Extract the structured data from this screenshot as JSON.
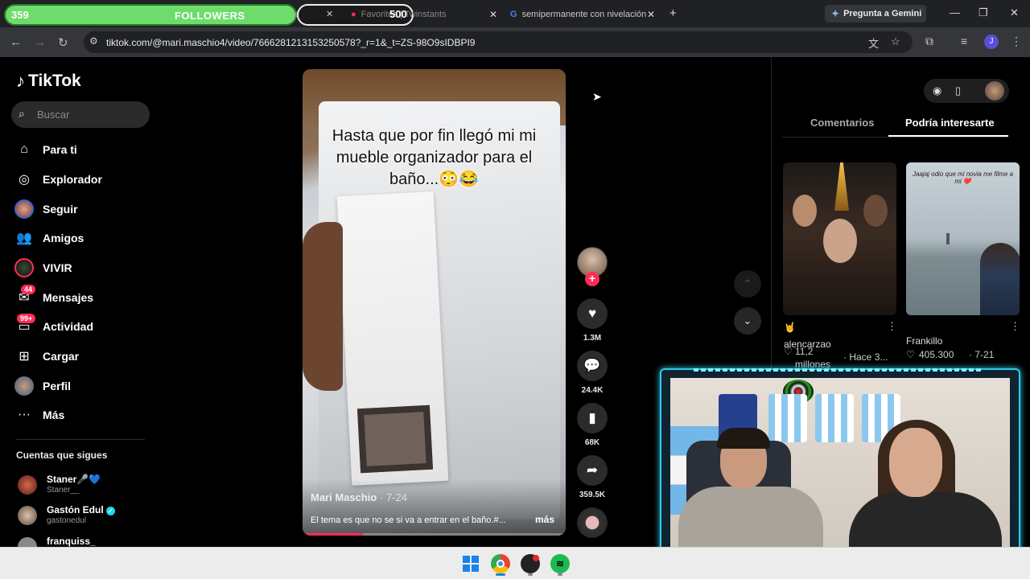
{
  "browser": {
    "tabs": [
      {
        "title": "Favoritos | Twinstants",
        "icon": "tiktok-favicon"
      },
      {
        "title": "semipermanente con nivelación",
        "icon": "google-favicon"
      }
    ],
    "gemini_label": "Pregunta a Gemini",
    "url": "tiktok.com/@mari.maschio4/video/7666281213153250578?_r=1&_t=ZS-98O9sIDBPI9",
    "profile_initial": "J"
  },
  "stream_overlay": {
    "followers_count": "359",
    "followers_label": "FOLLOWERS",
    "goal": "500"
  },
  "sidebar": {
    "brand": "TikTok",
    "search_placeholder": "Buscar",
    "items": [
      {
        "label": "Para ti",
        "icon": "home-icon"
      },
      {
        "label": "Explorador",
        "icon": "compass-icon"
      },
      {
        "label": "Seguir",
        "icon": "avatar"
      },
      {
        "label": "Amigos",
        "icon": "friends-icon"
      },
      {
        "label": "VIVIR",
        "icon": "live-avatar"
      },
      {
        "label": "Mensajes",
        "icon": "messages-icon",
        "badge": "44"
      },
      {
        "label": "Actividad",
        "icon": "activity-icon",
        "badge": "99+"
      },
      {
        "label": "Cargar",
        "icon": "upload-icon"
      },
      {
        "label": "Perfil",
        "icon": "avatar"
      },
      {
        "label": "Más",
        "icon": "more-icon"
      }
    ],
    "following_title": "Cuentas que sigues",
    "following": [
      {
        "name": "Staner🎤💙",
        "handle": "Staner__"
      },
      {
        "name": "Gastón Edul",
        "handle": "gastonedul",
        "verified": true
      },
      {
        "name": "franquiss_",
        "handle": ""
      }
    ]
  },
  "video": {
    "caption": "Hasta que por fin llegó mi mi mueble organizador para el baño...😳😂",
    "author": "Mari Maschio",
    "date": "7-24",
    "description": "El tema es que no se si va a entrar en el baño.#...",
    "more_label": "más",
    "progress_percent": 23
  },
  "actions": {
    "likes": "1.3M",
    "comments": "24.4K",
    "saves": "68K",
    "shares": "359.5K"
  },
  "right_panel": {
    "tabs": [
      "Comentarios",
      "Podría interesarte"
    ],
    "active_tab": "Podría interesarte",
    "cards": [
      {
        "emoji": "🤘",
        "author": "alencarzao",
        "likes": "11,2 millones",
        "date": "Hace 3..."
      },
      {
        "thumb_caption": "Jaajaj odio que mi novia me filme a mi ❤️",
        "author": "Frankillo",
        "likes": "405.300",
        "date": "7-21"
      }
    ]
  }
}
